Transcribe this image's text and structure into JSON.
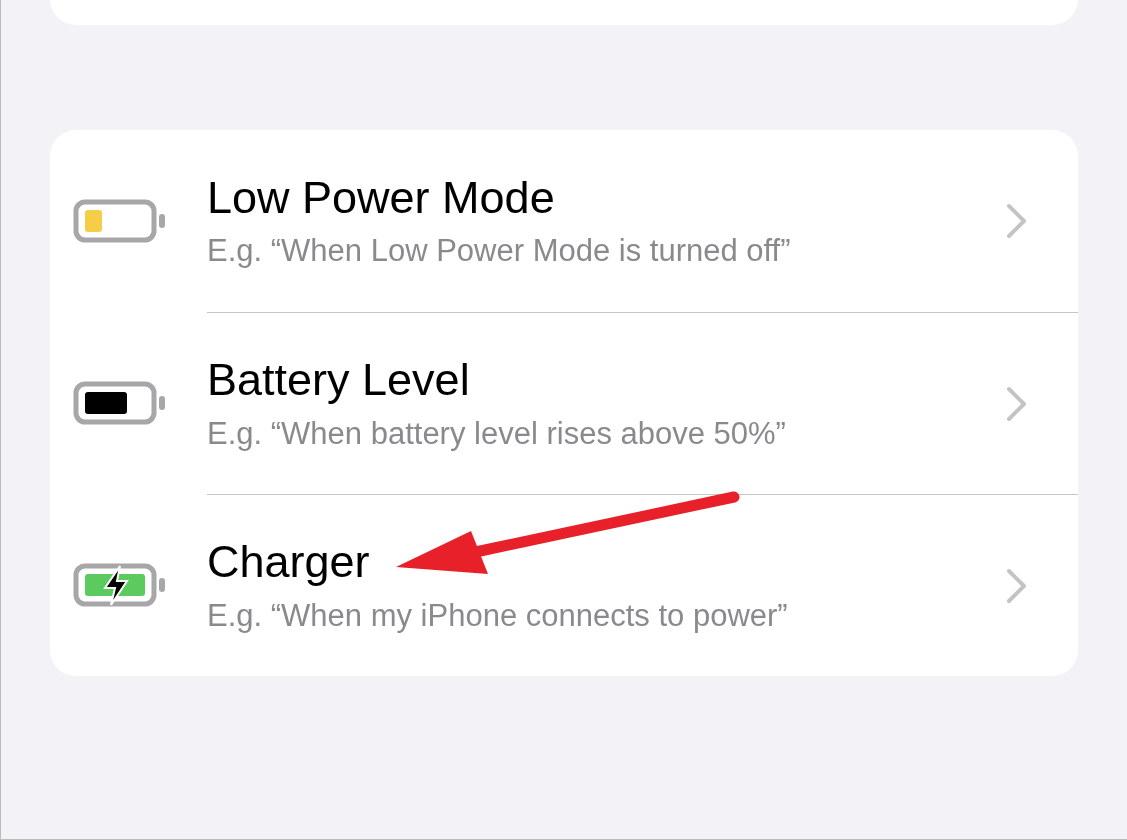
{
  "rows": [
    {
      "kind": "low",
      "title": "Low Power Mode",
      "subtitle": "E.g. “When Low Power Mode is turned off”"
    },
    {
      "kind": "level",
      "title": "Battery Level",
      "subtitle": "E.g. “When battery level rises above 50%”"
    },
    {
      "kind": "charging",
      "title": "Charger",
      "subtitle": "E.g. “When my iPhone connects to power”"
    }
  ]
}
